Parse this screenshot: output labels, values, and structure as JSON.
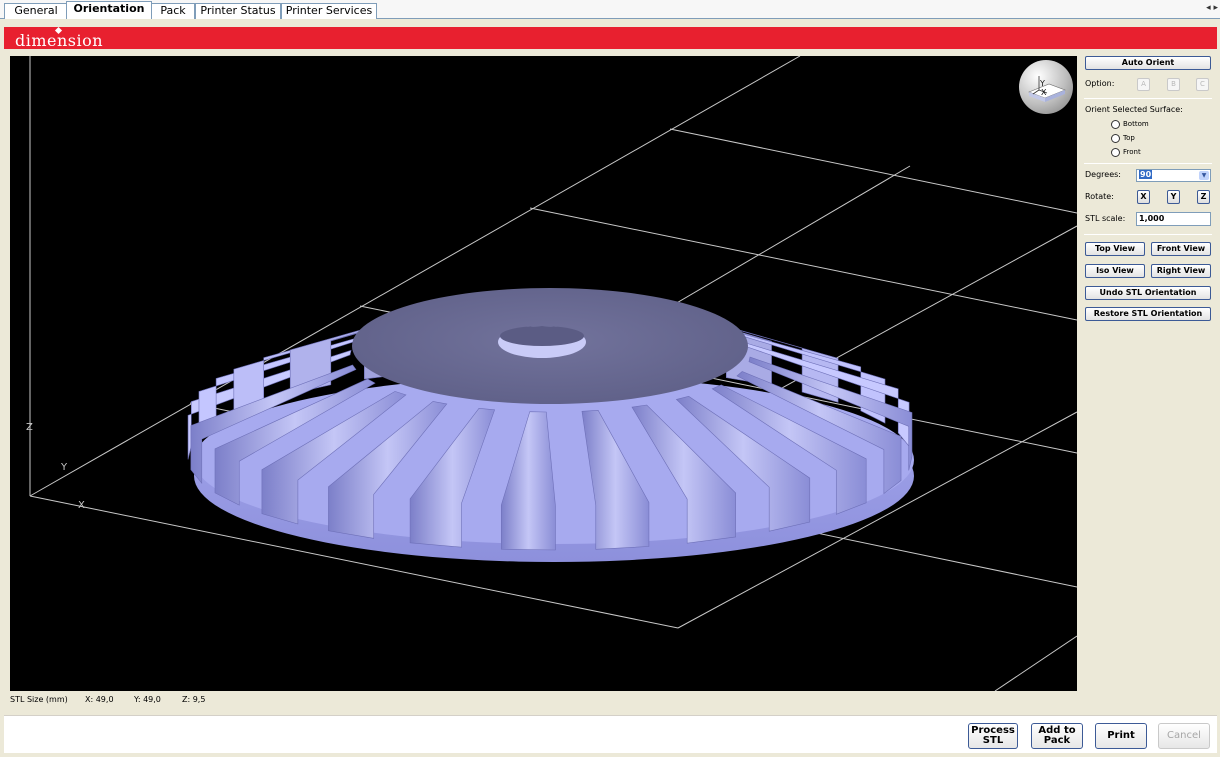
{
  "tabs": [
    {
      "label": "General",
      "active": false
    },
    {
      "label": "Orientation",
      "active": true
    },
    {
      "label": "Pack",
      "active": false
    },
    {
      "label": "Printer Status",
      "active": false
    },
    {
      "label": "Printer Services",
      "active": false
    }
  ],
  "brand": {
    "logo": "dimension",
    "color": "#e8202f"
  },
  "viewport": {
    "axes": {
      "x": "X",
      "y": "Y",
      "z": "Z"
    },
    "model_color": "#9fa2e6"
  },
  "panel": {
    "auto_orient": "Auto Orient",
    "option_label": "Option:",
    "options": [
      "A",
      "B",
      "C"
    ],
    "orient_surface_label": "Orient Selected Surface:",
    "surfaces": [
      "Bottom",
      "Top",
      "Front"
    ],
    "degrees_label": "Degrees:",
    "degrees_value": "90",
    "rotate_label": "Rotate:",
    "rotate_axes": [
      "X",
      "Y",
      "Z"
    ],
    "stl_scale_label": "STL scale:",
    "stl_scale_value": "1,000",
    "top_view": "Top View",
    "front_view": "Front View",
    "iso_view": "Iso View",
    "right_view": "Right View",
    "undo": "Undo STL Orientation",
    "restore": "Restore STL Orientation"
  },
  "status": {
    "label": "STL Size (mm)",
    "x": "X: 49,0",
    "y": "Y: 49,0",
    "z": "Z: 9,5"
  },
  "footer": {
    "process_l1": "Process",
    "process_l2": "STL",
    "add_l1": "Add to",
    "add_l2": "Pack",
    "print": "Print",
    "cancel": "Cancel"
  }
}
